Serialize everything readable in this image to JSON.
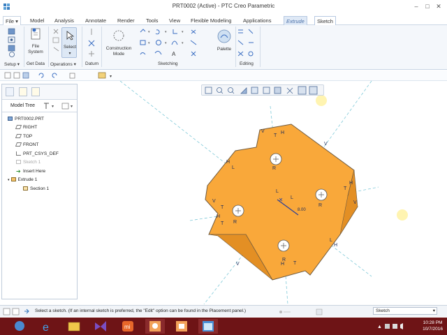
{
  "window": {
    "title": "PRT0002 (Active) - PTC Creo Parametric",
    "controls": [
      "minimize-icon",
      "maximize-icon",
      "close-icon"
    ]
  },
  "menu": {
    "file": "File",
    "tabs": [
      "Model",
      "Analysis",
      "Annotate",
      "Render",
      "Tools",
      "View",
      "Flexible Modeling",
      "Applications"
    ],
    "context_tabs": [
      "Extrude",
      "Sketch"
    ]
  },
  "ribbon": {
    "file_system_label": "File\nSystem",
    "select_label": "Select",
    "construction_mode_label": "Construction\nMode",
    "palette_label": "Palette",
    "groups": [
      "Setup",
      "Get Data",
      "Operations",
      "Datum",
      "Sketching",
      "Editing"
    ]
  },
  "left_panel": {
    "tree_label": "Model Tree",
    "items": [
      {
        "label": "PRT0002.PRT",
        "icon": "part-icon"
      },
      {
        "label": "RIGHT",
        "icon": "datum-plane-icon"
      },
      {
        "label": "TOP",
        "icon": "datum-plane-icon"
      },
      {
        "label": "FRONT",
        "icon": "datum-plane-icon"
      },
      {
        "label": "PRT_CSYS_DEF",
        "icon": "csys-icon"
      },
      {
        "label": "Sketch 1",
        "icon": "sketch-icon"
      },
      {
        "label": "Insert Here",
        "icon": "insert-arrow-icon"
      },
      {
        "label": "Extrude 1",
        "icon": "extrude-icon"
      },
      {
        "label": "Section 1",
        "icon": "section-icon"
      }
    ]
  },
  "graphics": {
    "constraint_labels": {
      "L1": "L",
      "R1": "R",
      "H": "H",
      "V": "V",
      "T": "T",
      "dim_value": "8.00"
    }
  },
  "status": {
    "message": "Select a sketch. (If an internal sketch is preferred, the \"Edit\" option can be found in the Placement panel.)",
    "filter_value": "Sketch"
  },
  "taskbar": {
    "time": "10:28 PM",
    "date": "10/7/2016",
    "apps": [
      "windows-start-icon",
      "ie-icon",
      "file-explorer-icon",
      "visual-studio-icon",
      "mi-icon",
      "creo-icon",
      "creo-icon-2",
      "window-icon"
    ]
  },
  "colors": {
    "part_fill": "#f9a83a",
    "part_edge": "#6e5a40",
    "datum_line": "#7fc9d8",
    "taskbar": "#6e1416",
    "accent_blue": "#4a70a8"
  }
}
